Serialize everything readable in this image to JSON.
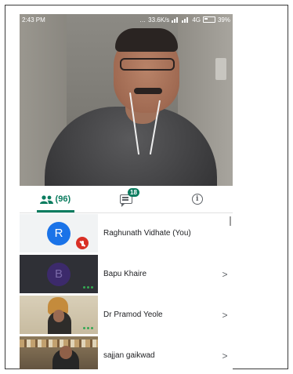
{
  "status_bar": {
    "time": "2:43 PM",
    "network_speed": "33.6K/s",
    "network_type": "4G",
    "battery": "39%"
  },
  "tabs": {
    "people_count": "(96)",
    "chat_badge": "18",
    "info_glyph": "i"
  },
  "participants": [
    {
      "initial": "R",
      "name": "Raghunath Vidhate (You)",
      "muted": true,
      "avatar_color": "#1a73e8"
    },
    {
      "initial": "B",
      "name": "Bapu Khaire",
      "chevron": ">"
    },
    {
      "name": "Dr Pramod Yeole",
      "chevron": ">"
    },
    {
      "name": "sajjan gaikwad",
      "chevron": ">"
    }
  ],
  "colors": {
    "accent": "#0b7c5f",
    "mute": "#d93025",
    "speaking_dots": "#34a853"
  },
  "icons": {
    "people_tab": "people-icon",
    "chat_tab": "chat-icon",
    "info_tab": "info-icon",
    "muted": "mic-off-icon"
  }
}
